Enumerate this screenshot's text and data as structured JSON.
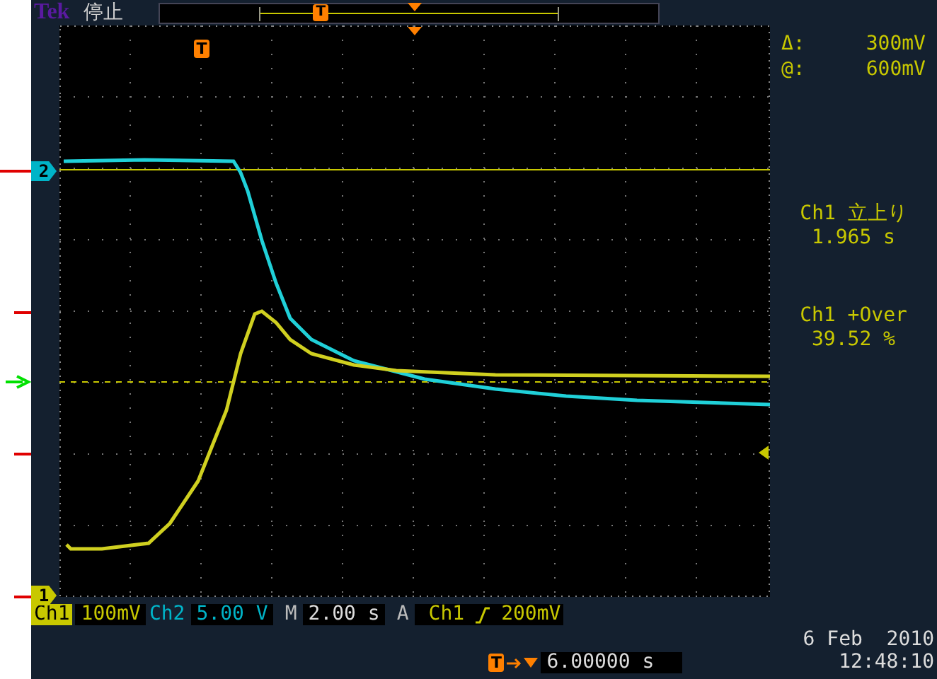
{
  "brand": "Tek",
  "status": "停止",
  "record_trigger_marker": "T",
  "screen_trigger_marker": "T",
  "channel_markers": [
    {
      "label": "2",
      "color": "#00b4c8"
    },
    {
      "label": "1",
      "color": "#c8c800"
    }
  ],
  "cursor_readout": [
    {
      "symbol": "Δ:",
      "value": "300mV"
    },
    {
      "symbol": "@:",
      "value": "600mV"
    }
  ],
  "measurements": [
    {
      "label": "Ch1 立上り",
      "value": "1.965 s"
    },
    {
      "label": "Ch1 +Over",
      "value": "39.52 %"
    }
  ],
  "settings": [
    {
      "kind": "channel",
      "label": "Ch1",
      "value": "100mV",
      "color": "#c8c800"
    },
    {
      "kind": "channel",
      "label": "Ch2",
      "value": "5.00 V",
      "color": "#00b4c8"
    },
    {
      "kind": "timebase",
      "label": "M",
      "value": "2.00 s"
    },
    {
      "kind": "trigger",
      "label": "A",
      "source": "Ch1",
      "value": "200mV"
    }
  ],
  "trigger_position": {
    "marker": "T",
    "value": "6.00000 s"
  },
  "date": "6 Feb  2010",
  "time": "12:48:10"
}
